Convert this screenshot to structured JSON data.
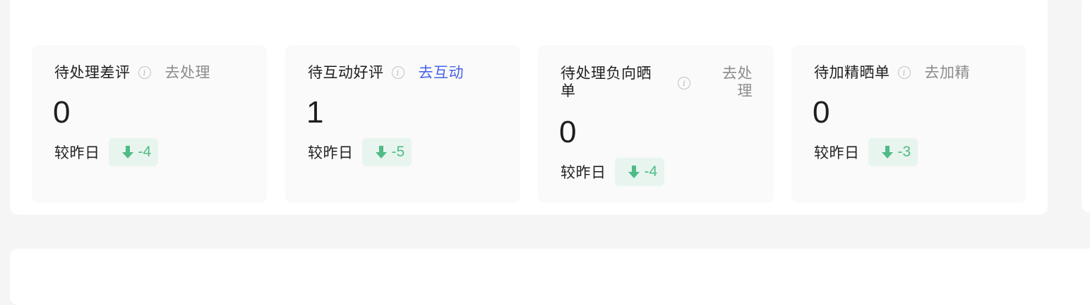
{
  "cards": [
    {
      "title": "待处理差评",
      "action": "去处理",
      "value": "0",
      "compare_label": "较昨日",
      "delta": "-4"
    },
    {
      "title": "待互动好评",
      "action": "去互动",
      "value": "1",
      "compare_label": "较昨日",
      "delta": "-5"
    },
    {
      "title": "待处理负向晒单",
      "action": "去处理",
      "value": "0",
      "compare_label": "较昨日",
      "delta": "-4"
    },
    {
      "title": "待加精晒单",
      "action": "去加精",
      "value": "0",
      "compare_label": "较昨日",
      "delta": "-3"
    }
  ],
  "colors": {
    "accent": "#4a63e8",
    "positive": "#4fbb86",
    "delta_bg": "#e8f5ee"
  },
  "icons": {
    "info": "info-circle-icon",
    "trend": "arrow-down-icon"
  }
}
